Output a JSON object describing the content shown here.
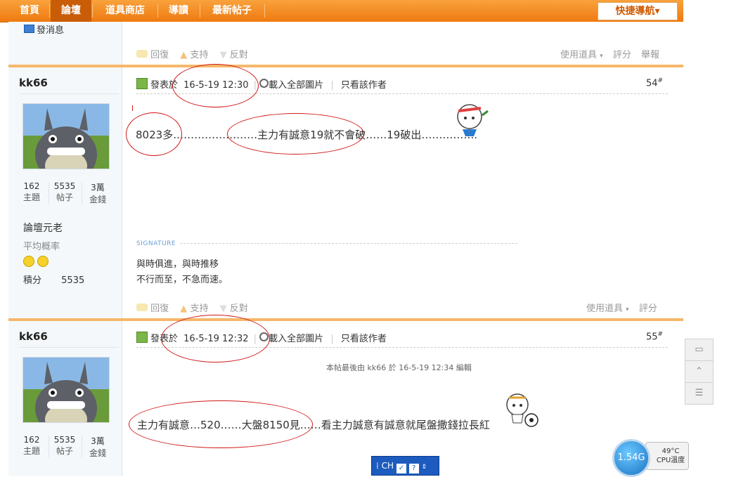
{
  "topnav": {
    "items": [
      "首頁",
      "論壇",
      "道具商店",
      "導讀",
      "最新帖子"
    ],
    "quick_nav": "快捷導航▾"
  },
  "prev_post": {
    "send_message": "發消息",
    "actions": {
      "reply": "回復",
      "support": "支持",
      "oppose": "反對",
      "use_tool": "使用道具",
      "rate": "評分",
      "report": "舉報"
    }
  },
  "post54": {
    "username": "kk66",
    "stats": [
      {
        "value": "162",
        "label": "主題"
      },
      {
        "value": "5535",
        "label": "帖子"
      },
      {
        "value": "3萬",
        "label": "金錢"
      }
    ],
    "rank": "論壇元老",
    "avg_label": "平均概率",
    "points_label": "積分",
    "points_value": "5535",
    "posted_prefix": "發表於",
    "timestamp": "16-5-19 12:30",
    "load_images": "載入全部圖片",
    "only_author": "只看該作者",
    "floor": "54",
    "content": "8023多……………………主力有誠意19就不會破……19破出…………….",
    "signature_label": "SIGNATURE",
    "signature_lines": [
      "與時俱進，與時推移",
      "不行而至，不急而速。"
    ],
    "actions": {
      "reply": "回復",
      "support": "支持",
      "oppose": "反對",
      "use_tool": "使用道具",
      "rate": "評分"
    }
  },
  "post55": {
    "username": "kk66",
    "stats": [
      {
        "value": "162",
        "label": "主題"
      },
      {
        "value": "5535",
        "label": "帖子"
      },
      {
        "value": "3萬",
        "label": "金錢"
      }
    ],
    "posted_prefix": "發表於",
    "timestamp": "16-5-19 12:32",
    "load_images": "載入全部圖片",
    "only_author": "只看該作者",
    "floor": "55",
    "edit_note": "本帖最後由 kk66 於 16-5-19 12:34 編輯",
    "content": "主力有誠意…520……大盤8150見……看主力誠意有誠意就尾盤撒錢拉長紅"
  },
  "widgets": {
    "ime_label": "CH",
    "cpu_value": "1.54G",
    "cpu_temp": "49°C",
    "cpu_temp_label": "CPU溫度"
  }
}
